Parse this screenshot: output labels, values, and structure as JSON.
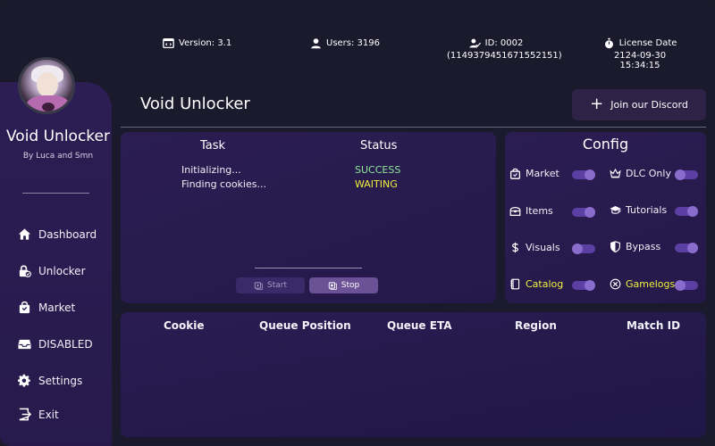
{
  "header": {
    "version": "Version: 3.1",
    "users": "Users: 3196",
    "id": "ID: 0002",
    "id_number": "(1149379451671552151)",
    "license_label": "License Date",
    "license_date": "2124-09-30 15:34:15"
  },
  "sidebar": {
    "app_name": "Void Unlocker",
    "author": "By Luca and Smn",
    "items": [
      {
        "label": "Dashboard",
        "icon": "home-icon"
      },
      {
        "label": "Unlocker",
        "icon": "lock-icon"
      },
      {
        "label": "Market",
        "icon": "bag-icon"
      },
      {
        "label": "DISABLED",
        "icon": "inbox-icon"
      },
      {
        "label": "Settings",
        "icon": "gear-icon"
      },
      {
        "label": "Exit",
        "icon": "exit-icon"
      }
    ]
  },
  "main": {
    "title": "Void Unlocker",
    "discord_button": "Join our Discord"
  },
  "task_panel": {
    "task_header": "Task",
    "status_header": "Status",
    "rows": [
      {
        "task": "Initializing...",
        "status": "SUCCESS"
      },
      {
        "task": "Finding cookies...",
        "status": "WAITING"
      }
    ],
    "start_label": "Start",
    "stop_label": "Stop"
  },
  "config": {
    "title": "Config",
    "items": [
      {
        "label": "Market",
        "icon": "bag-icon",
        "on": true
      },
      {
        "label": "DLC Only",
        "icon": "crown-icon",
        "on": false
      },
      {
        "label": "Items",
        "icon": "chest-icon",
        "on": true
      },
      {
        "label": "Tutorials",
        "icon": "graduation-cap-icon",
        "on": true
      },
      {
        "label": "Visuals",
        "icon": "dollar-icon",
        "on": false
      },
      {
        "label": "Bypass",
        "icon": "shield-icon",
        "on": true
      },
      {
        "label": "Catalog",
        "icon": "book-icon",
        "on": true
      },
      {
        "label": "Gamelogs",
        "icon": "close-circle-icon",
        "on": false
      }
    ]
  },
  "queue": {
    "columns": [
      "Cookie",
      "Queue Position",
      "Queue ETA",
      "Region",
      "Match ID"
    ]
  },
  "colors": {
    "success": "#8fe89a",
    "waiting": "#f1ef3f",
    "accent": "#5b3fa3",
    "highlight_label": "#f1ef3f"
  }
}
